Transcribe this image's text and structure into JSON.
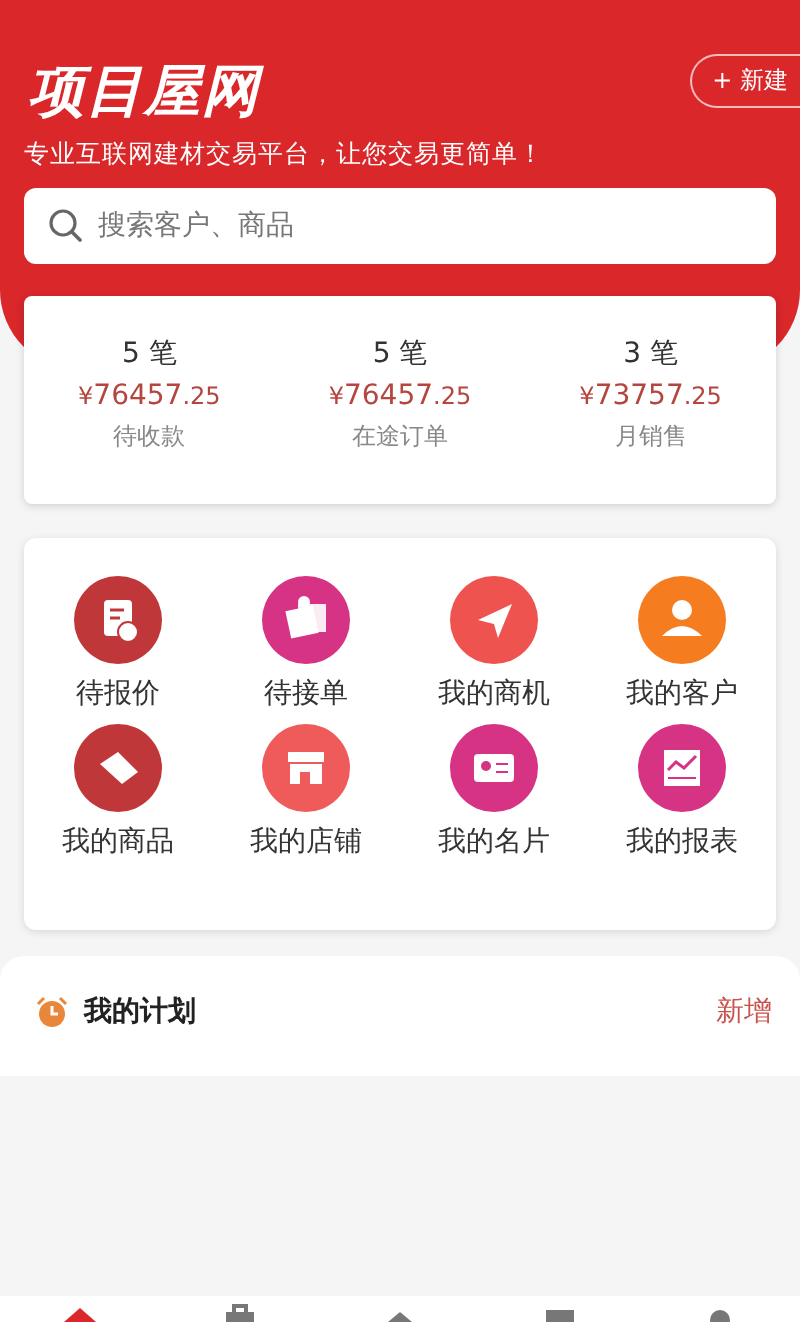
{
  "header": {
    "logo": "项目屋网",
    "new_button": "+ 新建",
    "slogan": "专业互联网建材交易平台，让您交易更简单！",
    "search": {
      "placeholder": "搜索客户、商品"
    }
  },
  "stats": [
    {
      "count": "5 笔",
      "currency": "¥",
      "amount": "76457",
      "cents": ".25",
      "label": "待收款"
    },
    {
      "count": "5 笔",
      "currency": "¥",
      "amount": "76457",
      "cents": ".25",
      "label": "在途订单"
    },
    {
      "count": "3 笔",
      "currency": "¥",
      "amount": "73757",
      "cents": ".25",
      "label": "月销售"
    }
  ],
  "shortcuts": [
    {
      "label": "待报价",
      "kind": "quote",
      "color": "#c0373a"
    },
    {
      "label": "待接单",
      "kind": "order",
      "color": "#d63384"
    },
    {
      "label": "我的商机",
      "kind": "send",
      "color": "#ef5350"
    },
    {
      "label": "我的客户",
      "kind": "person",
      "color": "#f57c1f"
    },
    {
      "label": "我的商品",
      "kind": "tag",
      "color": "#c0373a"
    },
    {
      "label": "我的店铺",
      "kind": "shop",
      "color": "#ef5a5a"
    },
    {
      "label": "我的名片",
      "kind": "card",
      "color": "#d63384"
    },
    {
      "label": "我的报表",
      "kind": "report",
      "color": "#d63384"
    }
  ],
  "plan": {
    "title": "我的计划",
    "add": "新增"
  },
  "tabs": [
    {
      "kind": "home",
      "selected": true
    },
    {
      "kind": "bag",
      "selected": false
    },
    {
      "kind": "house",
      "selected": false
    },
    {
      "kind": "box",
      "selected": false
    },
    {
      "kind": "person",
      "selected": false
    }
  ]
}
